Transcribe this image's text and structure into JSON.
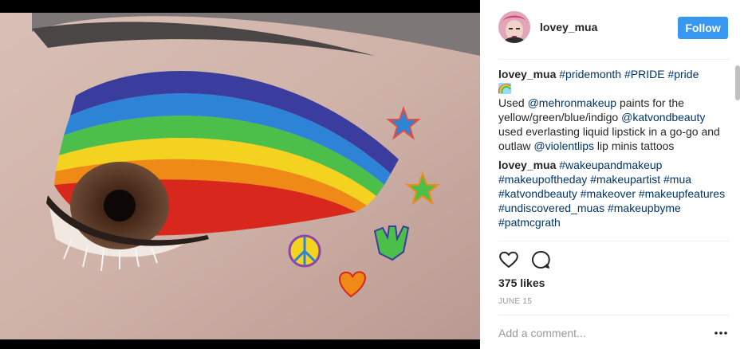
{
  "post": {
    "username": "lovey_mua",
    "follow_label": "Follow",
    "likes": "375 likes",
    "date": "JUNE 15",
    "comment_placeholder": "Add a comment..."
  },
  "caption": {
    "username": "lovey_mua",
    "tags": "#pridemonth #PRIDE #pride",
    "text_1": "Used ",
    "mention_1": "@mehronmakeup",
    "text_2": " paints for the yellow/green/blue/indigo ",
    "mention_2": "@katvondbeauty",
    "text_3": " used everlasting liquid lipstick in a go-go and outlaw ",
    "mention_3": "@violentlips",
    "text_4": " lip minis tattoos"
  },
  "comment_2": {
    "username": "lovey_mua",
    "tags": "#wakeupandmakeup #makeupoftheday #makeupartist #mua #katvondbeauty #makeover #makeupfeatures #undiscovered_muas #makeupbyme #patmcgrath"
  },
  "icons": {
    "like": "heart-icon",
    "comment": "comment-bubble-icon",
    "more": "more-options-icon",
    "emoji": "rainbow-emoji"
  },
  "colors": {
    "follow_button": "#3897f0",
    "hashtag": "#003569",
    "date": "#999999"
  }
}
